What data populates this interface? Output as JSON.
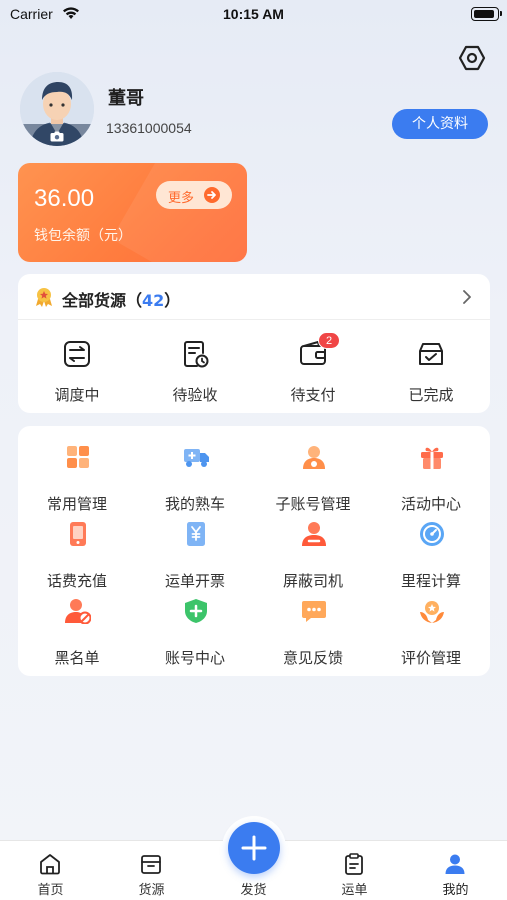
{
  "status_bar": {
    "carrier": "Carrier",
    "time": "10:15 AM"
  },
  "profile": {
    "name": "董哥",
    "phone": "13361000054",
    "edit_button": "个人资料"
  },
  "wallet": {
    "amount": "36.00",
    "label": "钱包余额（元）",
    "more_label": "更多"
  },
  "orders": {
    "title": "全部货源",
    "count_open": "（",
    "count": "42",
    "count_close": "）",
    "items": [
      {
        "label": "调度中",
        "icon": "dispatch-icon"
      },
      {
        "label": "待验收",
        "icon": "inspection-icon"
      },
      {
        "label": "待支付",
        "icon": "wallet-icon",
        "badge": "2"
      },
      {
        "label": "已完成",
        "icon": "completed-box-icon"
      }
    ]
  },
  "services": [
    {
      "label": "常用管理",
      "icon": "grid-icon"
    },
    {
      "label": "我的熟车",
      "icon": "truck-icon"
    },
    {
      "label": "子账号管理",
      "icon": "sub-account-icon"
    },
    {
      "label": "活动中心",
      "icon": "gift-icon"
    },
    {
      "label": "话费充值",
      "icon": "phone-icon"
    },
    {
      "label": "运单开票",
      "icon": "invoice-icon"
    },
    {
      "label": "屏蔽司机",
      "icon": "block-driver-icon"
    },
    {
      "label": "里程计算",
      "icon": "mileage-icon"
    },
    {
      "label": "黑名单",
      "icon": "blacklist-icon"
    },
    {
      "label": "账号中心",
      "icon": "account-shield-icon"
    },
    {
      "label": "意见反馈",
      "icon": "feedback-icon"
    },
    {
      "label": "评价管理",
      "icon": "rating-icon"
    }
  ],
  "tabbar": [
    {
      "label": "首页",
      "icon": "home-icon"
    },
    {
      "label": "货源",
      "icon": "cargo-icon"
    },
    {
      "label": "发货",
      "icon": "plus-icon"
    },
    {
      "label": "运单",
      "icon": "waybill-icon"
    },
    {
      "label": "我的",
      "icon": "user-icon",
      "active": true
    }
  ],
  "colors": {
    "accent": "#3b7cf0",
    "wallet": "#ff7d3f",
    "badge": "#f04646"
  }
}
